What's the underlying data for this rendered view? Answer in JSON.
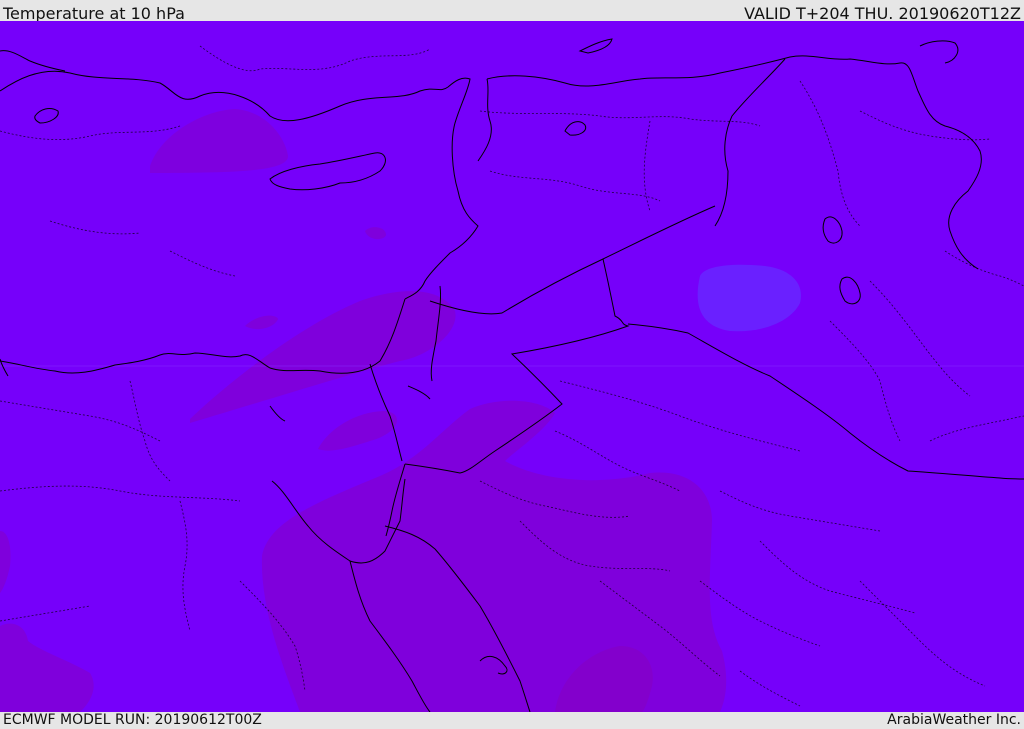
{
  "header": {
    "title": "Temperature at 10 hPa",
    "valid_time": "VALID T+204 THU. 20190620T12Z"
  },
  "footer": {
    "model_run": "ECMWF MODEL RUN: 20190612T00Z",
    "credit": "ArabiaWeather Inc."
  },
  "colors": {
    "background": "#e6e6e6",
    "field_base": "#7600fa",
    "field_warm": "#7f00dc",
    "field_cool": "#6a20ff",
    "coastline": "#000000"
  }
}
